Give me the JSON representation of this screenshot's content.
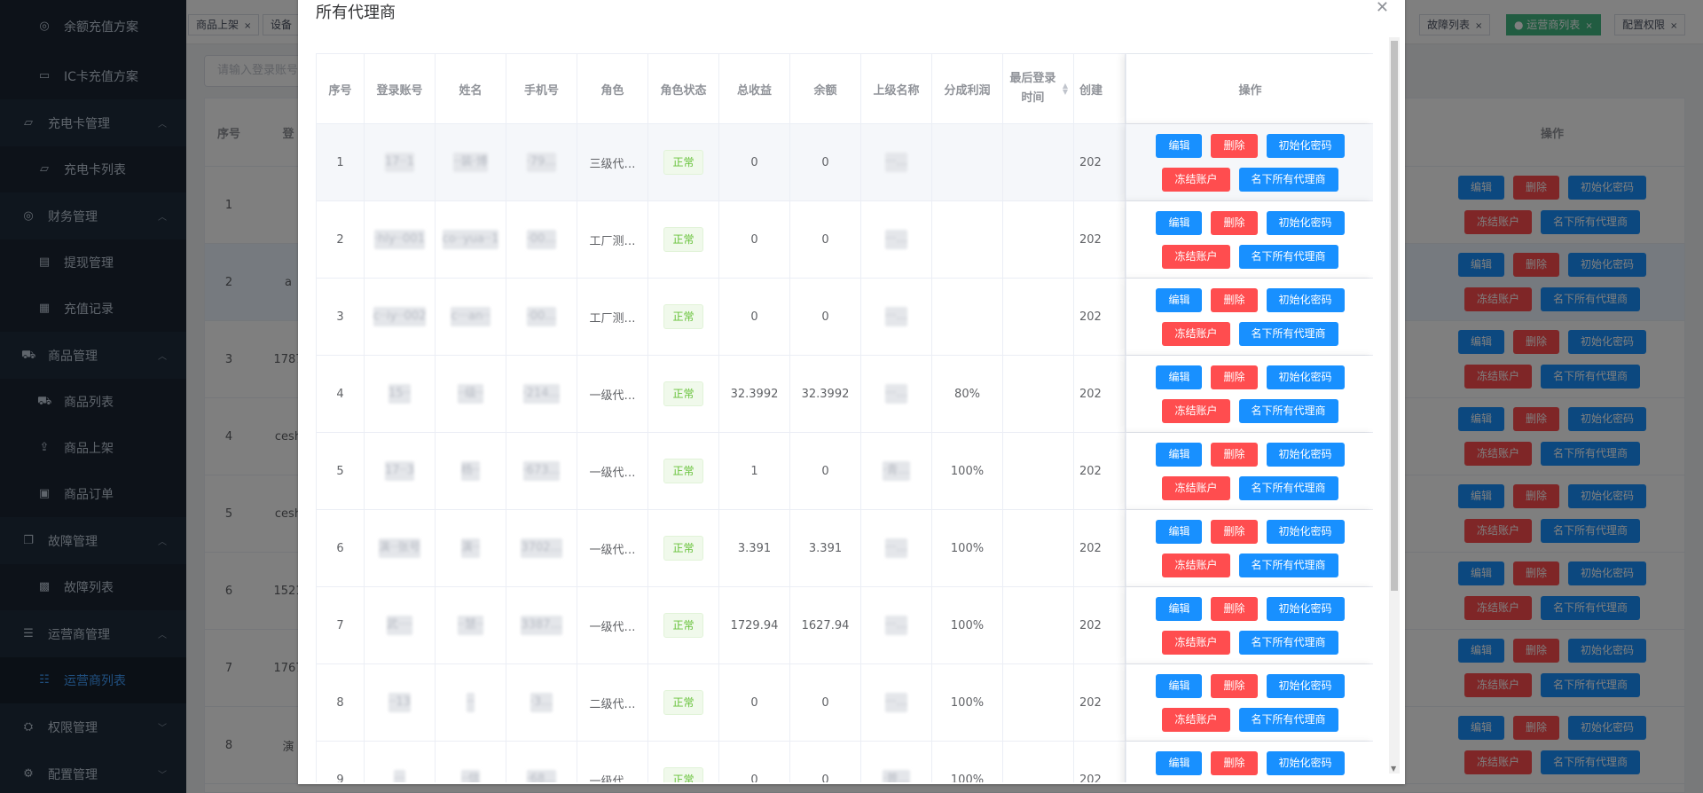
{
  "sidebar": {
    "items": [
      {
        "label": "余额充值方案",
        "icon": "database-icon",
        "sub": true
      },
      {
        "label": "IC卡充值方案",
        "icon": "card-icon",
        "sub": true
      },
      {
        "label": "充电卡管理",
        "icon": "folder-icon",
        "sub": false,
        "expanded": true
      },
      {
        "label": "充电卡列表",
        "icon": "folder-icon",
        "sub": true
      },
      {
        "label": "财务管理",
        "icon": "database-icon",
        "sub": false,
        "expanded": true
      },
      {
        "label": "提现管理",
        "icon": "document-icon",
        "sub": true
      },
      {
        "label": "充值记录",
        "icon": "list-icon",
        "sub": true
      },
      {
        "label": "商品管理",
        "icon": "cart-icon",
        "sub": false,
        "expanded": true
      },
      {
        "label": "商品列表",
        "icon": "cart-icon",
        "sub": true
      },
      {
        "label": "商品上架",
        "icon": "upload-icon",
        "sub": true
      },
      {
        "label": "商品订单",
        "icon": "order-icon",
        "sub": true
      },
      {
        "label": "故障管理",
        "icon": "copy-icon",
        "sub": false,
        "expanded": true
      },
      {
        "label": "故障列表",
        "icon": "fault-icon",
        "sub": true
      },
      {
        "label": "运营商管理",
        "icon": "bars-icon",
        "sub": false,
        "expanded": true
      },
      {
        "label": "运营商列表",
        "icon": "sliders-icon",
        "sub": true,
        "active": true
      },
      {
        "label": "权限管理",
        "icon": "lock-icon",
        "sub": false,
        "expanded": false
      },
      {
        "label": "配置管理",
        "icon": "gear-icon",
        "sub": false,
        "expanded": false
      }
    ]
  },
  "tags": {
    "items": [
      "商品上架",
      "设备",
      "故障列表",
      "运营商列表",
      "配置权限"
    ]
  },
  "bg": {
    "search_placeholder": "请输入登录账号",
    "col_index": "序号",
    "col_account": "登",
    "col_ops": "操作",
    "rows": [
      {
        "index": "1",
        "account": ""
      },
      {
        "index": "2",
        "account": "a"
      },
      {
        "index": "3",
        "account": "1787"
      },
      {
        "index": "4",
        "account": "cesh"
      },
      {
        "index": "5",
        "account": "cesh"
      },
      {
        "index": "6",
        "account": "1521"
      },
      {
        "index": "7",
        "account": "1767"
      },
      {
        "index": "8",
        "account": "演"
      }
    ]
  },
  "dialog": {
    "title": "所有代理商",
    "headers": {
      "index": "序号",
      "account": "登录账号",
      "name": "姓名",
      "phone": "手机号",
      "role": "角色",
      "role_status": "角色状态",
      "total_income": "总收益",
      "balance": "余额",
      "parent_name": "上级名称",
      "share_profit": "分成利润",
      "last_login": "最后登录时间",
      "created": "创建",
      "ops": "操作"
    },
    "buttons": {
      "edit": "编辑",
      "delete": "删除",
      "reset_password": "初始化密码",
      "freeze": "冻结账户",
      "subordinates": "名下所有代理商"
    },
    "rows": [
      {
        "index": "1",
        "account": "17··1",
        "name": "··装·博",
        "phone": "·79…",
        "role": "三级代…",
        "status": "正常",
        "income": "0",
        "balance": "0",
        "parent": "···…",
        "share": "",
        "last_login": "",
        "created": "202"
      },
      {
        "index": "2",
        "account": "·hly··001",
        "name": "co··yua··1",
        "phone": "·00…",
        "role": "工厂测…",
        "status": "正常",
        "income": "0",
        "balance": "0",
        "parent": "···…",
        "share": "",
        "last_login": "",
        "created": "202"
      },
      {
        "index": "3",
        "account": "c··iy··002",
        "name": "c···an··",
        "phone": "·00…",
        "role": "工厂测…",
        "status": "正常",
        "income": "0",
        "balance": "0",
        "parent": "···…",
        "share": "",
        "last_login": "",
        "created": "202"
      },
      {
        "index": "4",
        "account": "15··",
        "name": "··级··",
        "phone": "·214…",
        "role": "一级代…",
        "status": "正常",
        "income": "32.3992",
        "balance": "32.3992",
        "parent": "···…",
        "share": "80%",
        "last_login": "",
        "created": "202"
      },
      {
        "index": "5",
        "account": "17··3",
        "name": "杨··",
        "phone": "·673…",
        "role": "一级代…",
        "status": "正常",
        "income": "1",
        "balance": "0",
        "parent": "·青…",
        "share": "100%",
        "last_login": "",
        "created": "202"
      },
      {
        "index": "6",
        "account": "演··张号",
        "name": "演··",
        "phone": "3702…",
        "role": "一级代…",
        "status": "正常",
        "income": "3.391",
        "balance": "3.391",
        "parent": "···…",
        "share": "100%",
        "last_login": "",
        "created": "202"
      },
      {
        "index": "7",
        "account": "武····",
        "name": "··慧··",
        "phone": "3387…",
        "role": "一级代…",
        "status": "正常",
        "income": "1729.94",
        "balance": "1627.94",
        "parent": "···…",
        "share": "100%",
        "last_login": "",
        "created": "202"
      },
      {
        "index": "8",
        "account": "··13",
        "name": "··",
        "phone": "·3…",
        "role": "二级代…",
        "status": "正常",
        "income": "0",
        "balance": "0",
        "parent": "···…",
        "share": "100%",
        "last_login": "",
        "created": "202"
      },
      {
        "index": "9",
        "account": "···",
        "name": "··信",
        "phone": "·68…",
        "role": "一级代…",
        "status": "正常",
        "income": "0",
        "balance": "0",
        "parent": "·普…",
        "share": "100%",
        "last_login": "",
        "created": "202"
      }
    ]
  },
  "colors": {
    "sidebar_bg": "#1f2d3d",
    "active": "#409eff",
    "edit_btn": "#1890ff",
    "delete_btn": "#ff4d4f",
    "status_green": "#67c23a",
    "active_tag": "#42b983"
  }
}
